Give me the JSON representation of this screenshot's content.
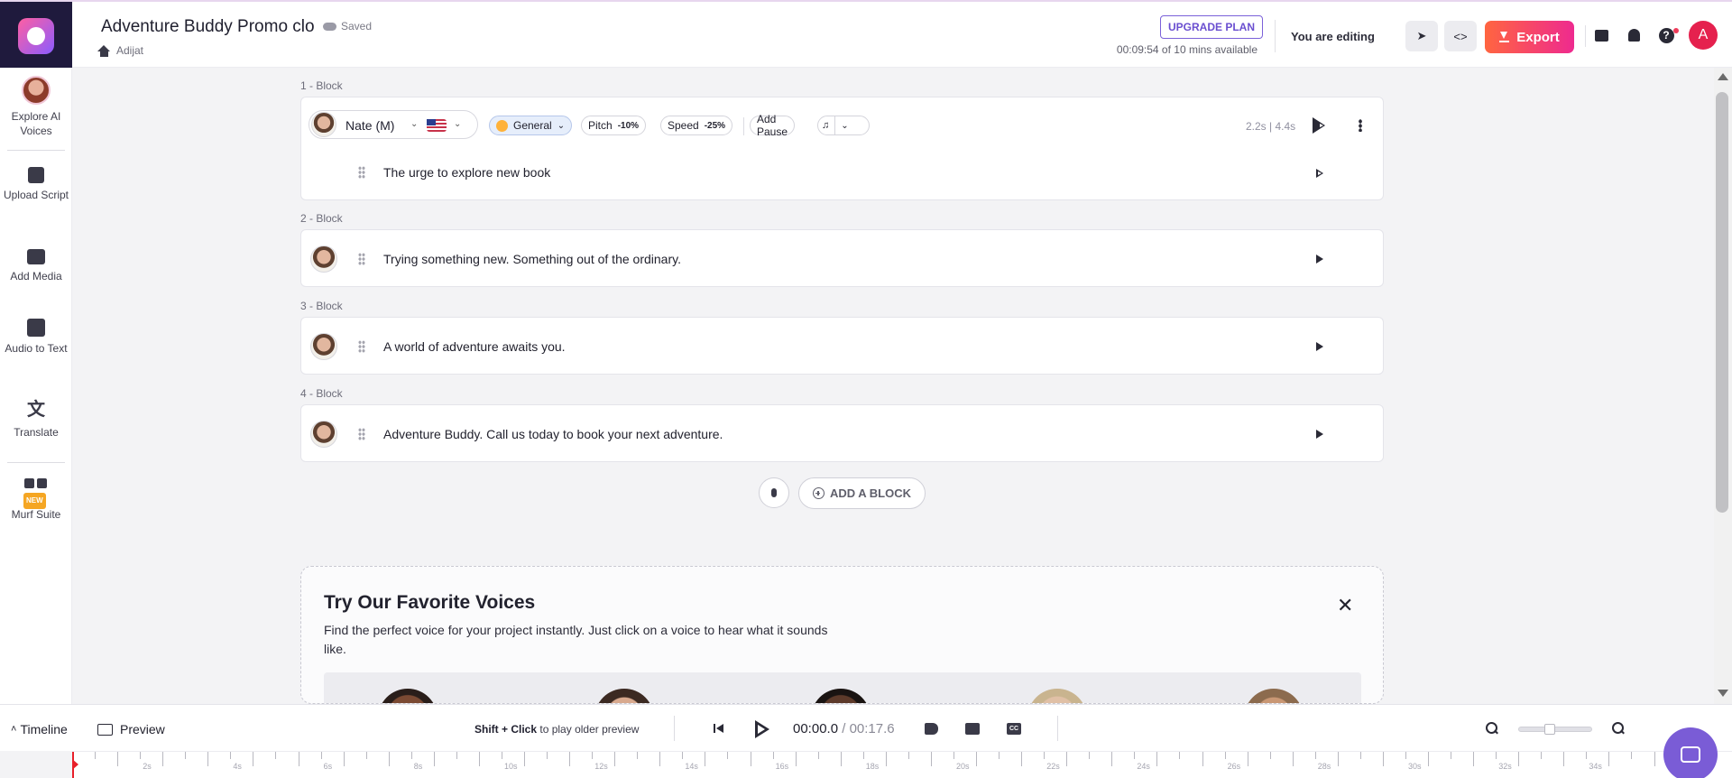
{
  "header": {
    "project_title": "Adventure Buddy Promo clo",
    "saved_label": "Saved",
    "breadcrumb": "Adijat",
    "upgrade_label": "UPGRADE PLAN",
    "availability": "00:09:54 of 10 mins available",
    "editing_label": "You are editing",
    "export_label": "Export",
    "avatar_letter": "A",
    "accent_color": "#ee2a8f"
  },
  "sidebar": {
    "items": [
      {
        "label": "Explore AI Voices",
        "icon": "voice-avatar-icon"
      },
      {
        "label": "Upload Script",
        "icon": "upload-script-icon"
      },
      {
        "label": "Add Media",
        "icon": "add-media-icon"
      },
      {
        "label": "Audio to Text",
        "icon": "audio-to-text-icon"
      },
      {
        "label": "Translate",
        "icon": "translate-icon"
      },
      {
        "label": "Murf Suite",
        "icon": "suite-icon",
        "badge": "NEW"
      }
    ]
  },
  "toolbar": {
    "voice_name": "Nate (M)",
    "style": "General",
    "pitch_label": "Pitch",
    "pitch_value": "-10%",
    "speed_label": "Speed",
    "speed_value": "-25%",
    "add_pause": "Add Pause",
    "duration": "2.2s | 4.4s"
  },
  "blocks": [
    {
      "label": "1 -  Block",
      "text": "The urge to explore new book"
    },
    {
      "label": "2 -  Block",
      "text": "Trying something new. Something out of the ordinary."
    },
    {
      "label": "3 -  Block",
      "text": "A world of adventure awaits you."
    },
    {
      "label": "4 -  Block",
      "text": "Adventure Buddy. Call us today to book your next adventure."
    }
  ],
  "add_block_label": "ADD A BLOCK",
  "favorites": {
    "title": "Try Our Favorite Voices",
    "description": "Find the perfect voice for your project instantly. Just click on a voice to hear what it sounds like."
  },
  "bottom": {
    "timeline_label": "Timeline",
    "preview_label": "Preview",
    "hint_bold": "Shift + Click",
    "hint_rest": "to play older preview",
    "current_time": "00:00.0",
    "total_time": "00:17.6",
    "zoom_level": 0.4
  },
  "ruler_labels": [
    "2s",
    "4s",
    "6s",
    "8s",
    "10s",
    "12s",
    "14s",
    "16s",
    "18s",
    "20s",
    "22s",
    "24s",
    "26s",
    "28s",
    "30s",
    "32s",
    "34s"
  ]
}
